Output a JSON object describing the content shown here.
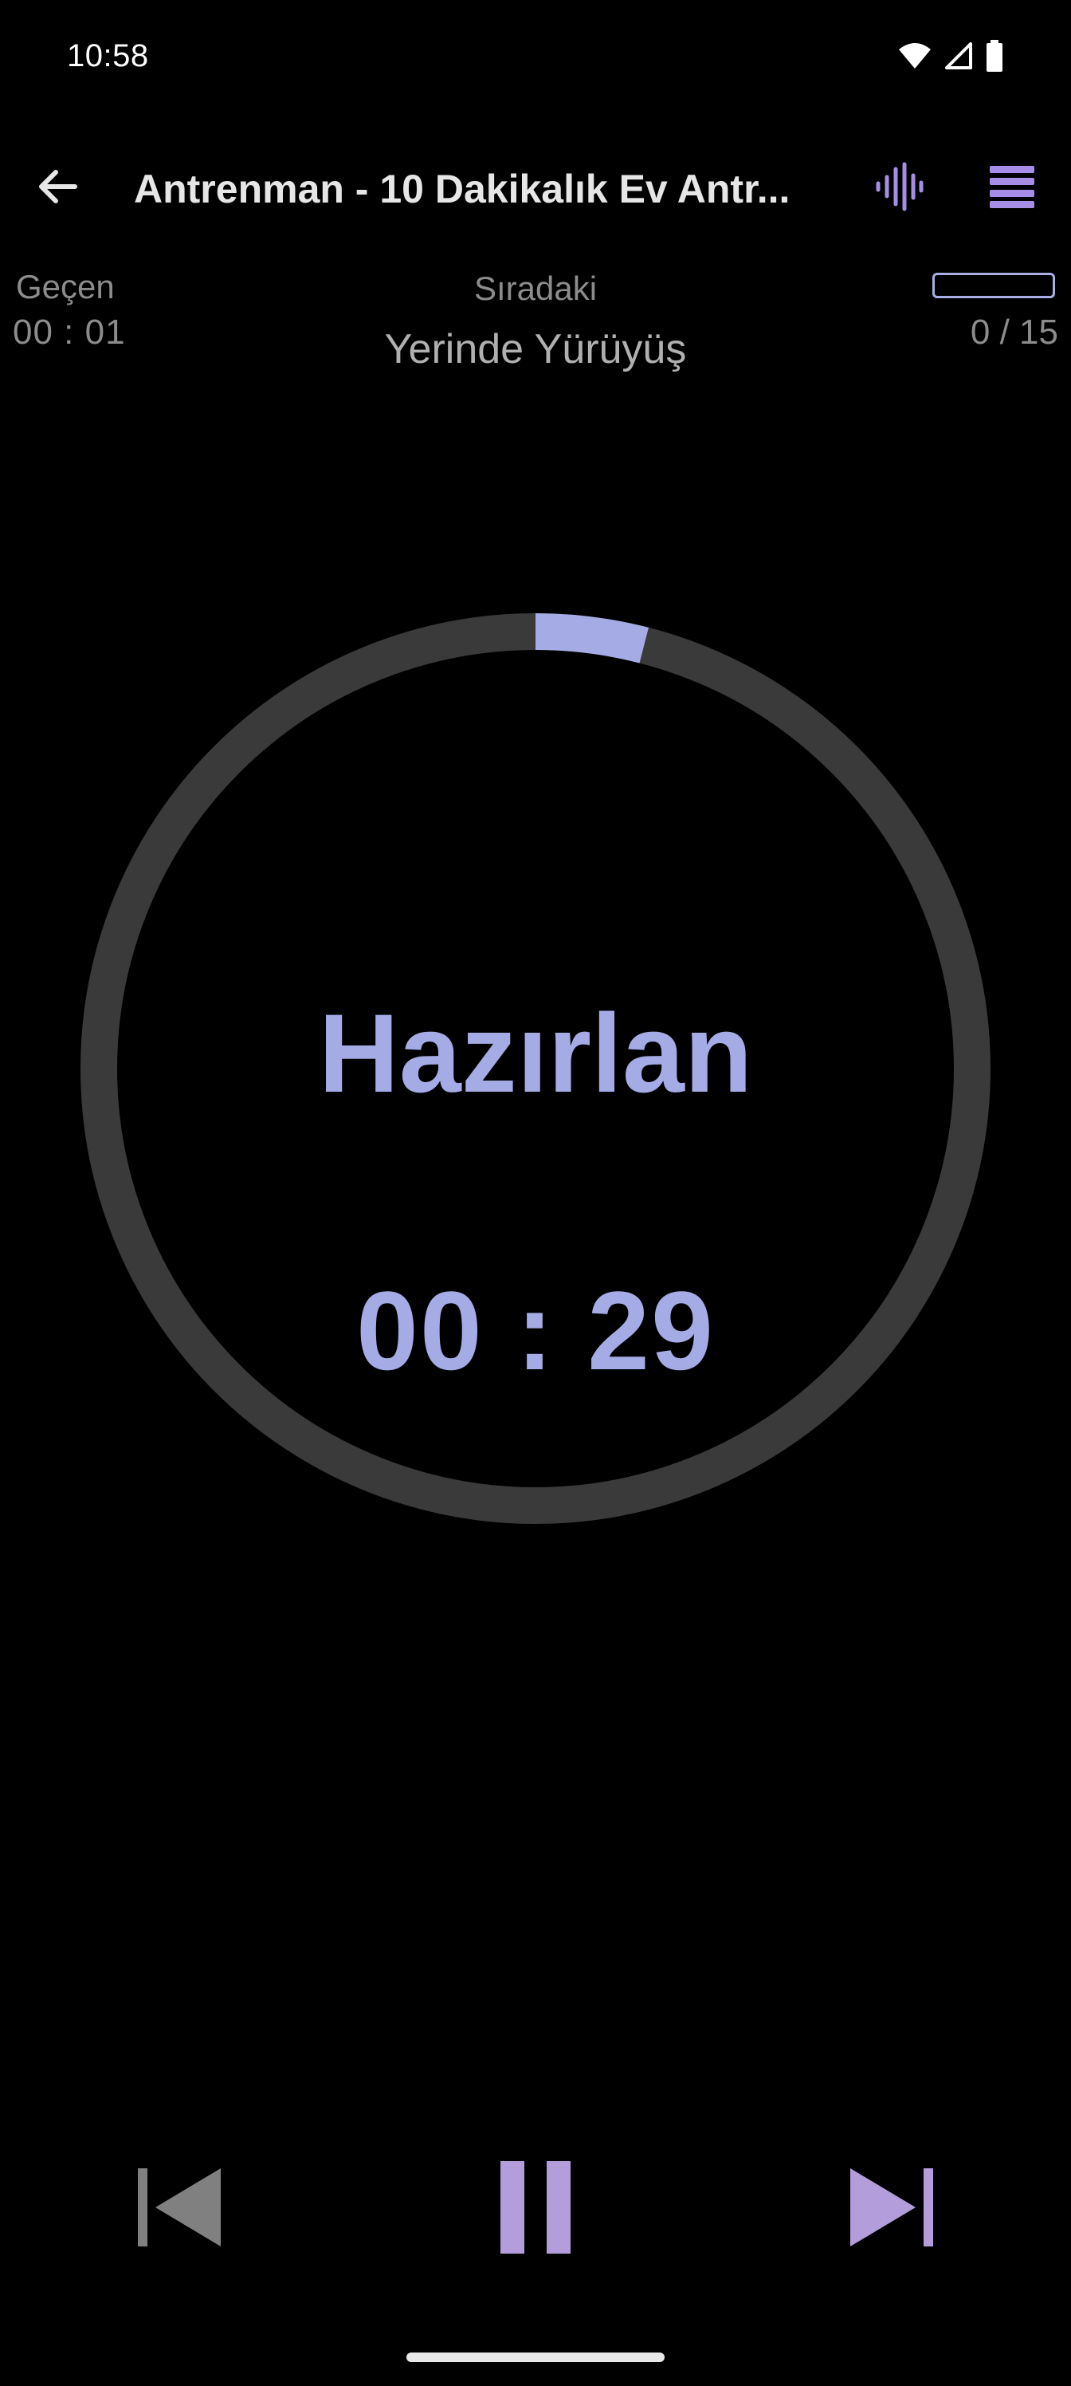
{
  "status_bar": {
    "time": "10:58",
    "icons": [
      "wifi-icon",
      "cell-signal-icon",
      "battery-icon"
    ]
  },
  "app_bar": {
    "back_icon": "arrow-left-icon",
    "title": "Antrenman - 10 Dakikalık Ev Antr...",
    "actions": [
      "sound-wave-icon",
      "list-icon"
    ]
  },
  "header": {
    "elapsed_label": "Geçen",
    "elapsed_value": "00 : 01",
    "next_label": "Sıradaki",
    "next_exercise": "Yerinde Yürüyüş",
    "progress_count": "0 / 15",
    "progress_fraction": 0.0
  },
  "timer": {
    "phase": "Hazırlan",
    "remaining": "00 : 29",
    "ring_progress_fraction": 0.04
  },
  "controls": {
    "previous_icon": "skip-previous-icon",
    "pause_icon": "pause-icon",
    "next_icon": "skip-next-icon"
  },
  "colors": {
    "accent": "#a5abe5",
    "accent_purple": "#b39ddb",
    "ring_track": "#3a3a3a",
    "disabled": "#808080",
    "background": "#000000"
  }
}
